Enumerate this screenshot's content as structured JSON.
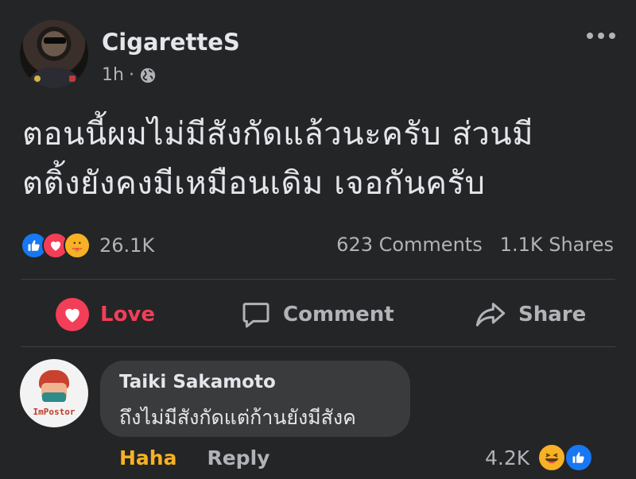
{
  "post": {
    "author": "CigaretteS",
    "time": "1h",
    "audience_icon": "globe-icon",
    "text_line1": "ตอนนี้ผมไม่มีสังกัดแล้วนะครับ ส่วนมี",
    "text_line2": "ตติ้งยังคงมีเหมือนเดิม เจอกันครับ",
    "reaction_count": "26.1K",
    "reactions": [
      "like-icon",
      "love-icon",
      "care-icon"
    ],
    "comments_count": "623 Comments",
    "shares_count": "1.1K Shares"
  },
  "actions": {
    "love_label": "Love",
    "comment_label": "Comment",
    "share_label": "Share"
  },
  "comment": {
    "author": "Taiki Sakamoto",
    "avatar_tag": "ImPostor",
    "text": "ถึงไม่มีสังกัดแต่ก้านยังมีสังค",
    "reaction_label": "Haha",
    "reply_label": "Reply",
    "reaction_count": "4.2K"
  },
  "colors": {
    "background": "#242526",
    "love": "#f33e58",
    "like": "#1877f2",
    "haha": "#f7b125",
    "secondary_text": "#b0b3b8"
  }
}
